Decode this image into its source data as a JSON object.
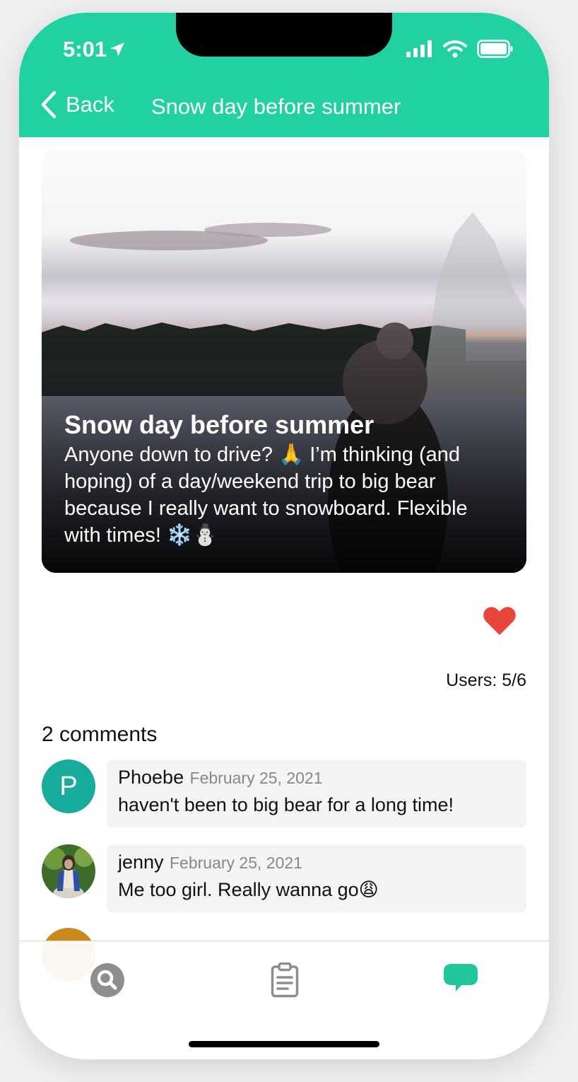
{
  "status_bar": {
    "time": "5:01",
    "color": "#ffffff"
  },
  "nav": {
    "back_label": "Back",
    "title": "Snow day before summer",
    "background": "#21d1a2"
  },
  "post": {
    "title": "Snow day before summer",
    "description": "Anyone down to drive? 🙏 I’m thinking (and hoping) of a day/weekend trip to big bear because I really want to snowboard. Flexible with times! ❄️⛄",
    "liked": true,
    "heart_color": "#e8453c",
    "users_label": "Users: 5/6"
  },
  "comments": {
    "count_label": "2 comments",
    "items": [
      {
        "avatar_letter": "P",
        "avatar_color": "#19ab9b",
        "author": "Phoebe",
        "date": "February 25, 2021",
        "text": "haven't been to big bear for a long time!"
      },
      {
        "avatar_letter": "",
        "avatar_color": "#3d6b2a",
        "author": "jenny",
        "date": "February 25, 2021",
        "text": "Me too girl. Really wanna go😩"
      }
    ]
  },
  "tabbar": {
    "tabs": [
      {
        "icon": "search-icon",
        "active": false
      },
      {
        "icon": "clipboard-icon",
        "active": false
      },
      {
        "icon": "chat-bubble-icon",
        "active": true
      }
    ],
    "active_color": "#21c79a",
    "inactive_color": "#8e8e8e"
  }
}
